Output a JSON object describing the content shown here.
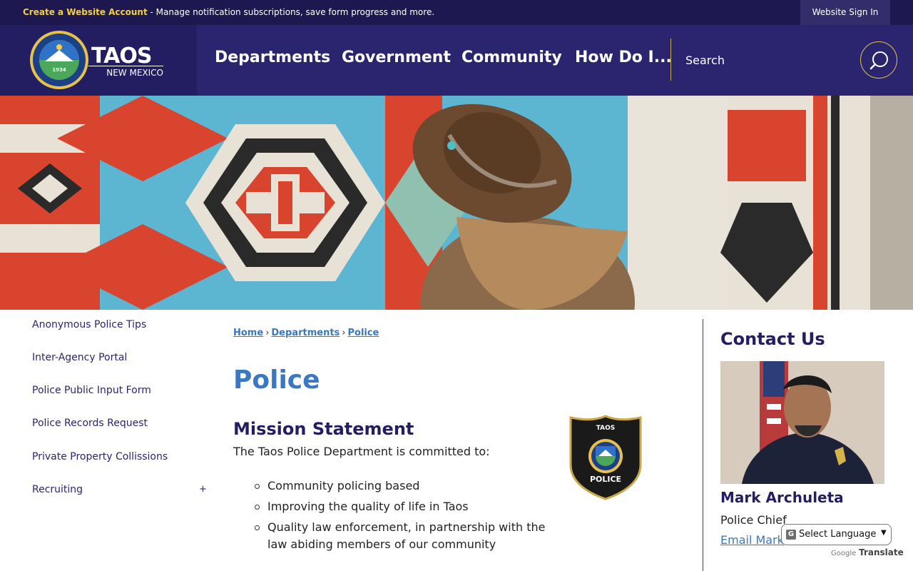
{
  "topbar": {
    "create_account_link": "Create a Website Account",
    "create_account_desc": " - Manage notification subscriptions, save form progress and more.",
    "signin_label": "Website Sign In"
  },
  "header": {
    "logo_year": "1934",
    "brand_name": "TAOS",
    "brand_sub": "NEW MEXICO",
    "nav": [
      "Departments",
      "Government",
      "Community",
      "How Do I..."
    ],
    "search_placeholder": "Search"
  },
  "sidebar": {
    "items": [
      "Anonymous Police Tips",
      "Inter-Agency Portal",
      "Police Public Input Form",
      "Police Records Request",
      "Private Property Collissions",
      "Recruiting"
    ],
    "recruiting_expand": "+"
  },
  "breadcrumb": {
    "home": "Home",
    "departments": "Departments",
    "police": "Police",
    "separator": "›"
  },
  "main": {
    "title": "Police",
    "mission_heading": "Mission Statement",
    "mission_intro": "The Taos Police Department is committed to:",
    "bullets": [
      "Community policing based",
      "Improving the quality of life in Taos",
      "Quality law enforcement, in partnership with the law abiding members of our community"
    ],
    "badge_top": "TAOS",
    "badge_bottom": "POLICE"
  },
  "contact": {
    "heading": "Contact Us",
    "name": "Mark Archuleta",
    "role": "Police Chief",
    "email_link": "Email Mark"
  },
  "translate": {
    "select_label": "Select Language",
    "powered_google": "Google",
    "powered_translate": "Translate"
  },
  "colors": {
    "topbar_bg": "#1d1850",
    "header_bg": "#2b2570",
    "accent_gold": "#f4d03f",
    "link_blue": "#3a78c2",
    "heading_navy": "#231e62"
  }
}
